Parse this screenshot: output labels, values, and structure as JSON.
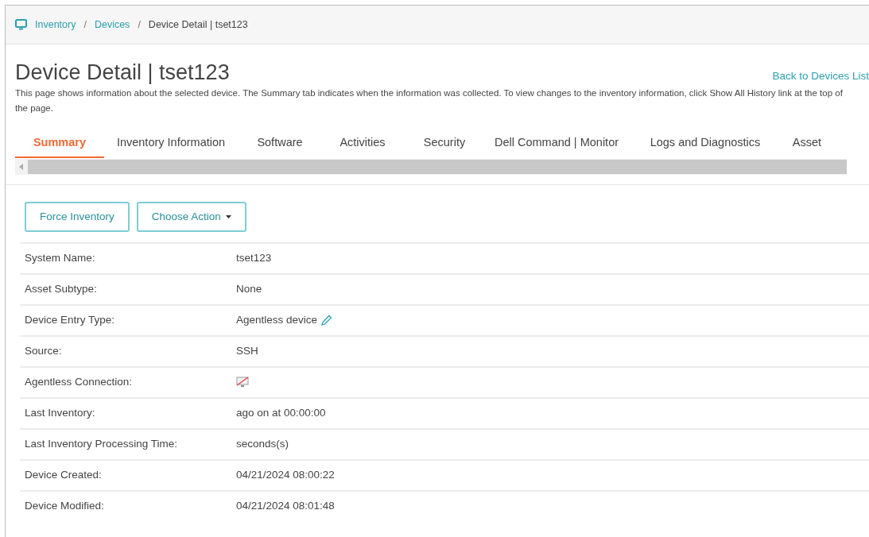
{
  "breadcrumb": [
    {
      "label": "Inventory",
      "kind": "link"
    },
    {
      "label": "/",
      "kind": "separator"
    },
    {
      "label": "Devices",
      "kind": "link"
    },
    {
      "label": "/",
      "kind": "separator"
    },
    {
      "label": "Device Detail | tset123",
      "kind": "current"
    }
  ],
  "title": "Device Detail | tset123",
  "back_link": "Back to Devices List",
  "description": "This page shows information about the selected device. The Summary tab indicates when the information was collected. To view changes to the inventory information, click Show All History link at the top of the page.",
  "tabs": [
    {
      "label": "Summary",
      "selected": true
    },
    {
      "label": "Inventory Information",
      "selected": false
    },
    {
      "label": "Software",
      "selected": false
    },
    {
      "label": "Activities",
      "selected": false
    },
    {
      "label": "Security",
      "selected": false
    },
    {
      "label": "Dell Command | Monitor",
      "selected": false
    },
    {
      "label": "Logs and Diagnostics",
      "selected": false
    },
    {
      "label": "Asset",
      "selected": false
    }
  ],
  "buttons": [
    {
      "label": "Force Inventory",
      "kind": "plain"
    },
    {
      "label": "Choose Action",
      "kind": "dropdown"
    }
  ],
  "fields": [
    {
      "label": "System Name:",
      "kind": "text",
      "value": "tset123"
    },
    {
      "label": "Asset Subtype:",
      "kind": "text",
      "value": "None"
    },
    {
      "label": "Device Entry Type:",
      "kind": "editable",
      "value": "Agentless device"
    },
    {
      "label": "Source:",
      "kind": "text",
      "value": "SSH"
    },
    {
      "label": "Agentless Connection:",
      "kind": "icon"
    },
    {
      "label": "Last Inventory:",
      "kind": "text",
      "value": "ago on at 00:00:00"
    },
    {
      "label": "Last Inventory Processing Time:",
      "kind": "text",
      "value": "seconds(s)"
    },
    {
      "label": "Device Created:",
      "kind": "text",
      "value": "04/21/2024 08:00:22"
    },
    {
      "label": "Device Modified:",
      "kind": "text",
      "value": "04/21/2024 08:01:48"
    }
  ]
}
